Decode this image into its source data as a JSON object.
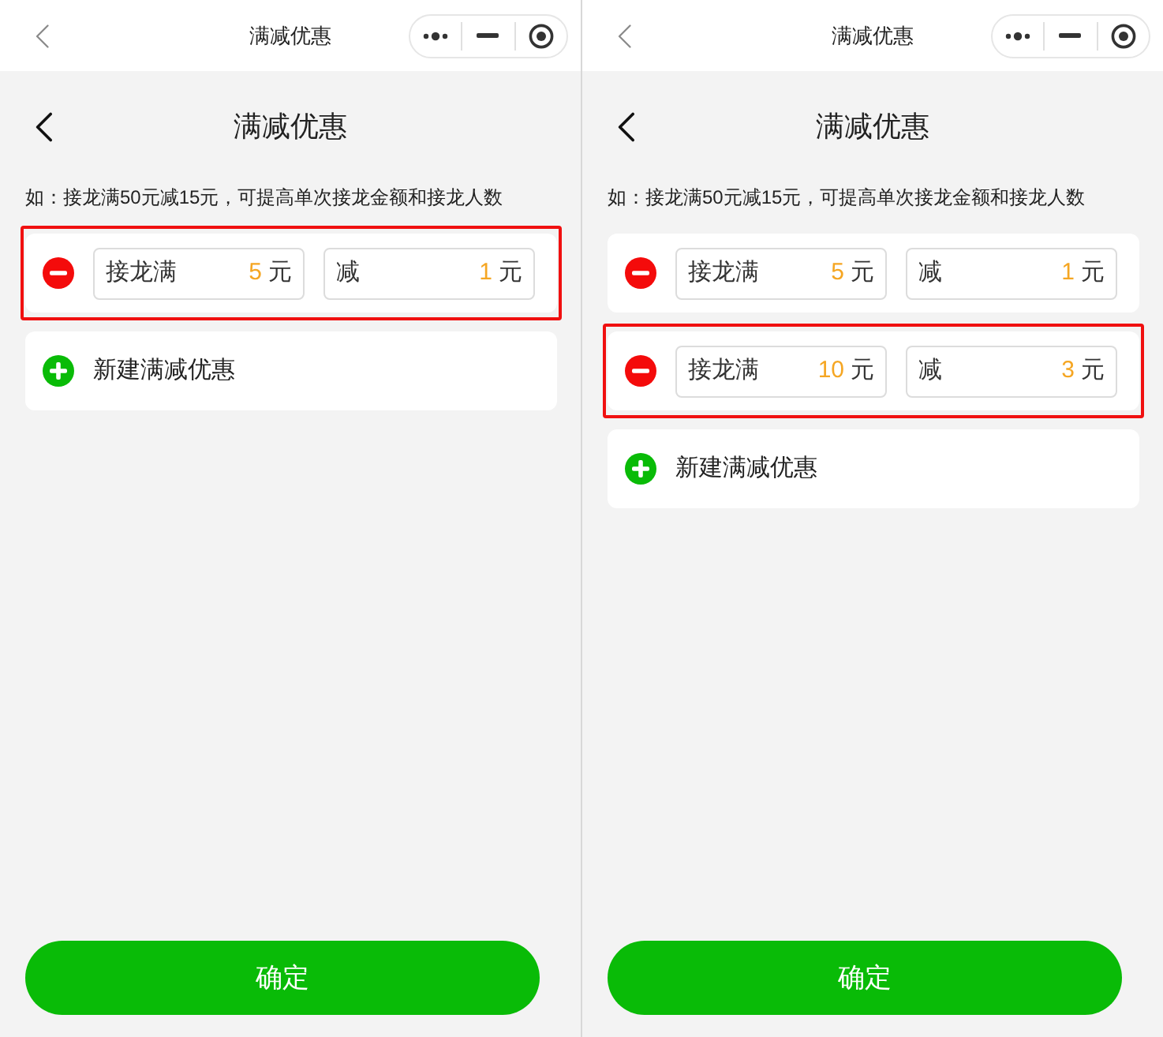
{
  "screens": [
    {
      "nav_bar": {
        "title": "满减优惠"
      },
      "header": {
        "title": "满减优惠"
      },
      "hint": "如：接龙满50元减15元，可提高单次接龙金额和接龙人数",
      "rules": [
        {
          "highlighted": true,
          "threshold": {
            "label": "接龙满",
            "value": "5",
            "unit": "元"
          },
          "discount": {
            "label": "减",
            "value": "1",
            "unit": "元"
          }
        }
      ],
      "add_button": "新建满减优惠",
      "confirm_button": "确定"
    },
    {
      "nav_bar": {
        "title": "满减优惠"
      },
      "header": {
        "title": "满减优惠"
      },
      "hint": "如：接龙满50元减15元，可提高单次接龙金额和接龙人数",
      "rules": [
        {
          "highlighted": false,
          "threshold": {
            "label": "接龙满",
            "value": "5",
            "unit": "元"
          },
          "discount": {
            "label": "减",
            "value": "1",
            "unit": "元"
          }
        },
        {
          "highlighted": true,
          "threshold": {
            "label": "接龙满",
            "value": "10",
            "unit": "元"
          },
          "discount": {
            "label": "减",
            "value": "3",
            "unit": "元"
          }
        }
      ],
      "add_button": "新建满减优惠",
      "confirm_button": "确定"
    }
  ]
}
